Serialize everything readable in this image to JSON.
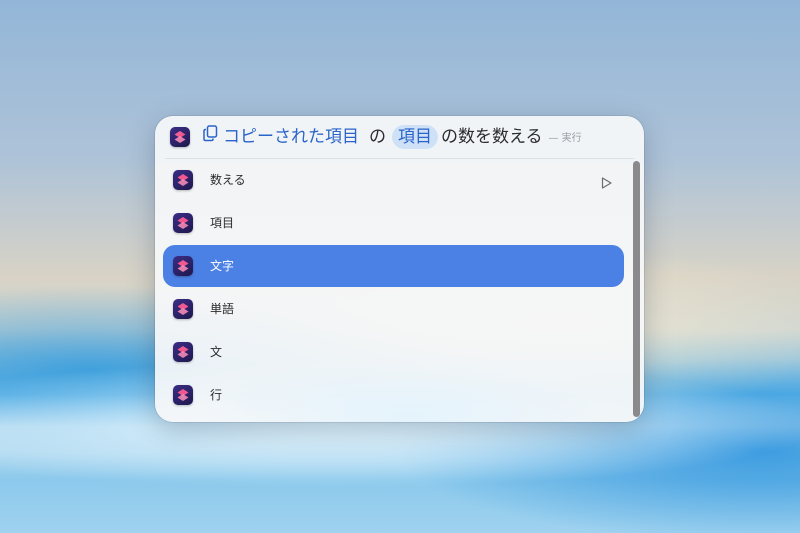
{
  "query": {
    "source_token": "コピーされた項目",
    "connector": "の",
    "parameter_token": "項目",
    "action_text": "の数を数える",
    "run_hint": "— 実行"
  },
  "suggestions": [
    {
      "label": "数える",
      "icon": "shortcuts-icon",
      "has_play": true,
      "selected": false
    },
    {
      "label": "項目",
      "icon": "shortcuts-icon",
      "has_play": false,
      "selected": false
    },
    {
      "label": "文字",
      "icon": "shortcuts-icon",
      "has_play": false,
      "selected": true
    },
    {
      "label": "単語",
      "icon": "shortcuts-icon",
      "has_play": false,
      "selected": false
    },
    {
      "label": "文",
      "icon": "shortcuts-icon",
      "has_play": false,
      "selected": false
    },
    {
      "label": "行",
      "icon": "shortcuts-icon",
      "has_play": false,
      "selected": false
    }
  ],
  "colors": {
    "accent_selected": "#4b80e4",
    "token_blue": "#2a63c9",
    "token_pill": "#cfe1f7"
  },
  "icons": {
    "app": "shortcuts-icon",
    "clipboard": "clipboard-icon",
    "play": "play-icon"
  }
}
